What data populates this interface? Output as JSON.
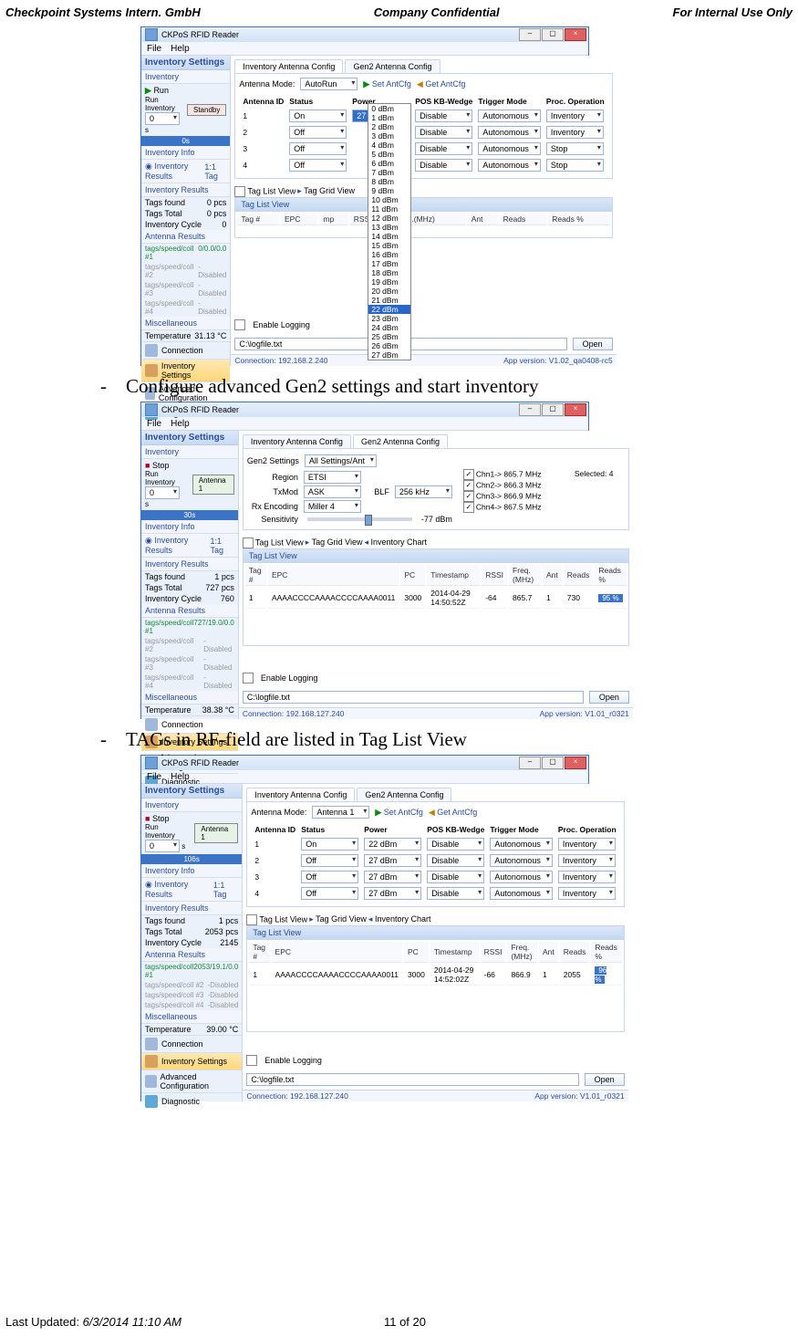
{
  "header": {
    "left": "Checkpoint Systems Intern. GmbH",
    "center": "Company Confidential",
    "right": "For Internal Use Only"
  },
  "footer": {
    "left_label": "Last Updated: ",
    "left_val": "6/3/2014 11:10 AM",
    "right": "11 of 20"
  },
  "bullets": {
    "b1": "Configure advanced Gen2 settings and start inventory",
    "b2": "TAGs in RF-field are listed in Tag List View"
  },
  "app": {
    "title": "CKPoS RFID Reader",
    "menu_file": "File",
    "menu_help": "Help"
  },
  "left": {
    "sect": "Inventory Settings",
    "sub_inv": "Inventory",
    "run": "Run",
    "stop": "Stop",
    "run_inv": "Run Inventory",
    "standby": "Standby",
    "antenna1": "Antenna 1",
    "time0": "0s",
    "time30": "30s",
    "time106": "106s",
    "info": "Inventory Info",
    "invres": "Inventory Results",
    "tag1": "1 Tag",
    "tag13": "1:1 Tag",
    "ir": "Inventory Results",
    "tf": "Tags found",
    "tt": "Tags Total",
    "ic": "Inventory Cycle",
    "ar": "Antenna Results",
    "a1": "tags/speed/coll #1",
    "a2": "tags/speed/coll #2",
    "a3": "tags/speed/coll #3",
    "a4": "tags/speed/coll #4",
    "v1a": "0/0.0/0.0",
    "v1b": "727/19.0/0.0",
    "v1c": "2053/19.1/0.0",
    "dis": "-Disabled",
    "misc": "Miscellaneous",
    "temp": "Temperature",
    "t1": "31.13 °C",
    "t2": "38.38 °C",
    "t3": "39.00 °C",
    "nav_conn": "Connection",
    "nav_inv": "Inventory Settings",
    "nav_adv": "Advanced Configuration",
    "nav_diag": "Diagnostic"
  },
  "win1": {
    "tab1": "Inventory Antenna Config",
    "tab2": "Gen2 Antenna Config",
    "ant_mode": "Antenna Mode:",
    "autorun": "AutoRun",
    "set": "Set AntCfg",
    "get": "Get AntCfg",
    "th": [
      "Antenna ID",
      "Status",
      "Power",
      "POS KB-Wedge",
      "Trigger Mode",
      "Proc. Operation"
    ],
    "rows": [
      {
        "id": "1",
        "status": "On",
        "power": "27 dBm",
        "kb": "Disable",
        "trig": "Autonomous",
        "op": "Inventory"
      },
      {
        "id": "2",
        "status": "Off",
        "power": "",
        "kb": "Disable",
        "trig": "Autonomous",
        "op": "Inventory"
      },
      {
        "id": "3",
        "status": "Off",
        "power": "",
        "kb": "Disable",
        "trig": "Autonomous",
        "op": "Stop"
      },
      {
        "id": "4",
        "status": "Off",
        "power": "",
        "kb": "Disable",
        "trig": "Autonomous",
        "op": "Stop"
      }
    ],
    "power_options": [
      "0 dBm",
      "1 dBm",
      "2 dBm",
      "3 dBm",
      "4 dBm",
      "5 dBm",
      "6 dBm",
      "7 dBm",
      "8 dBm",
      "9 dBm",
      "10 dBm",
      "11 dBm",
      "12 dBm",
      "13 dBm",
      "14 dBm",
      "15 dBm",
      "16 dBm",
      "17 dBm",
      "18 dBm",
      "19 dBm",
      "20 dBm",
      "21 dBm",
      "22 dBm",
      "23 dBm",
      "24 dBm",
      "25 dBm",
      "26 dBm",
      "27 dBm"
    ],
    "selected_power": "22 dBm",
    "tlv": "Tag List View",
    "tgv": "Tag Grid View",
    "list_th": [
      "Tag #",
      "EPC",
      "mp",
      "RSSI",
      "Freq.(MHz)",
      "Ant",
      "Reads",
      "Reads %"
    ],
    "log_en": "Enable Logging",
    "log_path": "C:\\logfile.txt",
    "log_open": "Open",
    "status_l": "Connection: 192.168.2.240",
    "status_r": "App version: V1.02_qa0408-rc5",
    "tf": "0 pcs",
    "tt": "0 pcs",
    "ic": "0"
  },
  "win2": {
    "tab1": "Inventory Antenna Config",
    "tab2": "Gen2 Antenna Config",
    "g2s": "Gen2 Settings",
    "asa": "All Settings/Ant",
    "region": "Region",
    "etsi": "ETSI",
    "txmod": "TxMod",
    "ask": "ASK",
    "blf": "BLF",
    "blfv": "256 kHz",
    "rxenc": "Rx Encoding",
    "miller": "Miller 4",
    "sens": "Sensitivity",
    "sensv": "-77 dBm",
    "chn": [
      "Chn1-> 865.7 MHz",
      "Chn2-> 866.3 MHz",
      "Chn3-> 866.9 MHz",
      "Chn4-> 867.5 MHz"
    ],
    "sel": "Selected: 4",
    "tlv": "Tag List View",
    "tgv": "Tag Grid View",
    "ich": "Inventory Chart",
    "list_th": [
      "Tag #",
      "EPC",
      "PC",
      "Timestamp",
      "RSSI",
      "Freq.(MHz)",
      "Ant",
      "Reads",
      "Reads %"
    ],
    "row": {
      "n": "1",
      "epc": "AAAACCCCAAAACCCCAAAA0011",
      "pc": "3000",
      "ts": "2014-04-29 14:50:52Z",
      "rssi": "-64",
      "freq": "865.7",
      "ant": "1",
      "reads": "730",
      "pct": "95 %"
    },
    "status_l": "Connection: 192.168.127.240",
    "status_r": "App version: V1.01_r0321",
    "tf": "1 pcs",
    "tt": "727 pcs",
    "ic": "760"
  },
  "win3": {
    "tab1": "Inventory Antenna Config",
    "tab2": "Gen2 Antenna Config",
    "ant_mode": "Antenna Mode:",
    "ant1": "Antenna 1",
    "set": "Set AntCfg",
    "get": "Get AntCfg",
    "th": [
      "Antenna ID",
      "Status",
      "Power",
      "POS KB-Wedge",
      "Trigger Mode",
      "Proc. Operation"
    ],
    "rows": [
      {
        "id": "1",
        "status": "On",
        "power": "22 dBm",
        "kb": "Disable",
        "trig": "Autonomous",
        "op": "Inventory"
      },
      {
        "id": "2",
        "status": "Off",
        "power": "27 dBm",
        "kb": "Disable",
        "trig": "Autonomous",
        "op": "Inventory"
      },
      {
        "id": "3",
        "status": "Off",
        "power": "27 dBm",
        "kb": "Disable",
        "trig": "Autonomous",
        "op": "Inventory"
      },
      {
        "id": "4",
        "status": "Off",
        "power": "27 dBm",
        "kb": "Disable",
        "trig": "Autonomous",
        "op": "Inventory"
      }
    ],
    "tlv": "Tag List View",
    "tgv": "Tag Grid View",
    "ich": "Inventory Chart",
    "list_th": [
      "Tag #",
      "EPC",
      "PC",
      "Timestamp",
      "RSSI",
      "Freq.(MHz)",
      "Ant",
      "Reads",
      "Reads %"
    ],
    "row": {
      "n": "1",
      "epc": "AAAACCCCAAAACCCCAAAA0011",
      "pc": "3000",
      "ts": "2014-04-29 14:52:02Z",
      "rssi": "-66",
      "freq": "866.9",
      "ant": "1",
      "reads": "2055",
      "pct": "96 %"
    },
    "status_l": "Connection: 192.168.127.240",
    "status_r": "App version: V1.01_r0321",
    "tf": "1 pcs",
    "tt": "2053 pcs",
    "ic": "2145"
  }
}
